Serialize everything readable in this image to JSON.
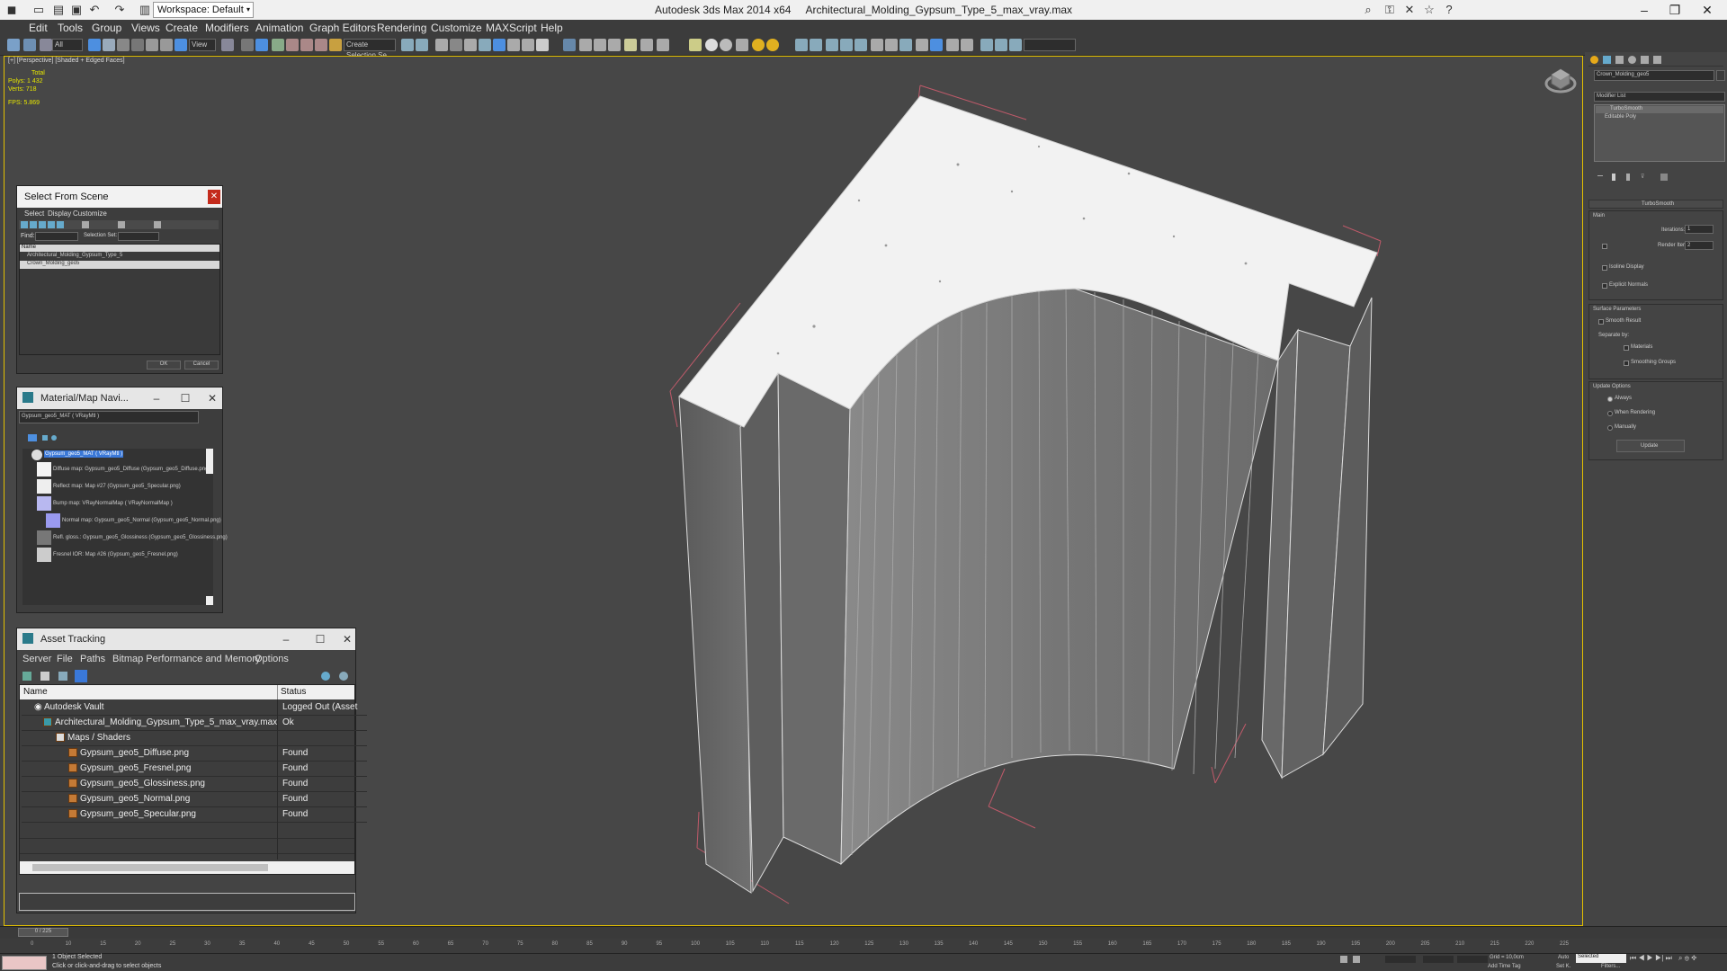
{
  "window": {
    "app_title": "Autodesk 3ds Max  2014 x64",
    "file_title": "Architectural_Molding_Gypsum_Type_5_max_vray.max",
    "workspace": "Workspace: Default"
  },
  "menu": [
    "Edit",
    "Tools",
    "Group",
    "Views",
    "Create",
    "Modifiers",
    "Animation",
    "Graph Editors",
    "Rendering",
    "Customize",
    "MAXScript",
    "Help"
  ],
  "toolbar": {
    "selection_filter": "All",
    "reference_coord": "View",
    "named_selection": "Create Selection Se"
  },
  "viewport": {
    "label": "[+] [Perspective] [Shaded + Edged Faces]",
    "stats_total_label": "Total",
    "polys_label": "Polys:",
    "polys_value": "1 432",
    "verts_label": "Verts:",
    "verts_value": "718",
    "fps_label": "FPS:",
    "fps_value": "5.869"
  },
  "command_panel": {
    "object_name": "Crown_Molding_geo5",
    "modifier_list_label": "Modifier List",
    "stack": [
      "TurboSmooth",
      "Editable Poly"
    ],
    "rollout_title": "TurboSmooth",
    "main_label": "Main",
    "iterations_label": "Iterations:",
    "iterations_value": "1",
    "render_iters_label": "Render Iters:",
    "render_iters_value": "2",
    "isoline_label": "Isoline Display",
    "explicit_normals_label": "Explicit Normals",
    "surface_params_label": "Surface Parameters",
    "smooth_result_label": "Smooth Result",
    "separate_by_label": "Separate by:",
    "materials_label": "Materials",
    "smoothing_groups_label": "Smoothing Groups",
    "update_options_label": "Update Options",
    "always_label": "Always",
    "when_rendering_label": "When Rendering",
    "manually_label": "Manually",
    "update_button": "Update"
  },
  "select_from_scene": {
    "title": "Select From Scene",
    "menu": [
      "Select",
      "Display",
      "Customize"
    ],
    "find_label": "Find:",
    "selection_set_label": "Selection Set:",
    "column_name": "Name",
    "items": [
      "Architectural_Molding_Gypsum_Type_5",
      "Crown_Molding_geo5"
    ],
    "ok": "OK",
    "cancel": "Cancel"
  },
  "material_navigator": {
    "title": "Material/Map Navi...",
    "current": "Gypsum_geo5_MAT  ( VRayMtl )",
    "tree": [
      "Gypsum_geo5_MAT  ( VRayMtl )",
      "Diffuse map: Gypsum_geo5_Diffuse (Gypsum_geo5_Diffuse.png)",
      "Reflect map: Map #27 (Gypsum_geo5_Specular.png)",
      "Bump map: VRayNormalMap  ( VRayNormalMap )",
      "Normal map: Gypsum_geo5_Normal (Gypsum_geo5_Normal.png)",
      "Refl. gloss.: Gypsum_geo5_Glossiness (Gypsum_geo5_Glossiness.png)",
      "Fresnel IOR: Map #26 (Gypsum_geo5_Fresnel.png)"
    ]
  },
  "asset_tracking": {
    "title": "Asset Tracking",
    "menu": [
      "Server",
      "File",
      "Paths",
      "Bitmap Performance and Memory",
      "Options"
    ],
    "col_name": "Name",
    "col_status": "Status",
    "rows": [
      {
        "name": "Autodesk Vault",
        "status": "Logged Out (Asset"
      },
      {
        "name": "Architectural_Molding_Gypsum_Type_5_max_vray.max",
        "status": "Ok"
      },
      {
        "name": "Maps / Shaders",
        "status": ""
      },
      {
        "name": "Gypsum_geo5_Diffuse.png",
        "status": "Found"
      },
      {
        "name": "Gypsum_geo5_Fresnel.png",
        "status": "Found"
      },
      {
        "name": "Gypsum_geo5_Glossiness.png",
        "status": "Found"
      },
      {
        "name": "Gypsum_geo5_Normal.png",
        "status": "Found"
      },
      {
        "name": "Gypsum_geo5_Specular.png",
        "status": "Found"
      }
    ]
  },
  "timeline": {
    "frame_counter": "0 / 225",
    "ticks": [
      "0",
      "10",
      "15",
      "20",
      "25",
      "30",
      "35",
      "40",
      "45",
      "50",
      "55",
      "60",
      "65",
      "70",
      "75",
      "80",
      "85",
      "90",
      "95",
      "100",
      "105",
      "110",
      "115",
      "120",
      "125",
      "130",
      "135",
      "140",
      "145",
      "150",
      "155",
      "160",
      "165",
      "170",
      "175",
      "180",
      "185",
      "190",
      "195",
      "200",
      "205",
      "210",
      "215",
      "220",
      "225"
    ]
  },
  "status": {
    "selected": "1 Object Selected",
    "prompt": "Click or click-and-drag to select objects",
    "grid": "Grid = 10,0cm",
    "auto": "Auto",
    "selected_mode": "Selected",
    "set_key": "Set K.",
    "filters": "Filters...",
    "add_time_tag": "Add Time Tag"
  }
}
